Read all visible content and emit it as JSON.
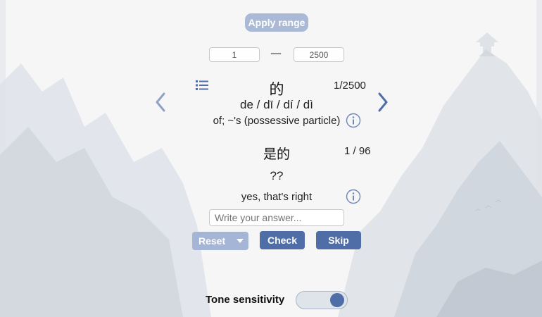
{
  "range": {
    "apply_label": "Apply range",
    "start_value": "1",
    "end_value": "2500",
    "separator": "—"
  },
  "card": {
    "character": "的",
    "counter": "1/2500",
    "pinyin": "de / dī / dí / dì",
    "meaning": "of; ~'s (possessive particle)"
  },
  "word": {
    "characters": "是的",
    "counter": "1 / 96",
    "pinyin": "??",
    "meaning": "yes, that's right"
  },
  "answer": {
    "placeholder": "Write your answer..."
  },
  "buttons": {
    "reset_label": "Reset",
    "check_label": "Check",
    "skip_label": "Skip"
  },
  "settings": {
    "tone_label": "Tone sensitivity",
    "tone_enabled": true
  },
  "icons": {
    "list": "list-icon",
    "prev": "chevron-left-icon",
    "next": "chevron-right-icon",
    "info": "info-icon",
    "dropdown": "caret-down-icon"
  },
  "colors": {
    "accent": "#4f6ea7",
    "accent_light": "#a9b9d6"
  }
}
